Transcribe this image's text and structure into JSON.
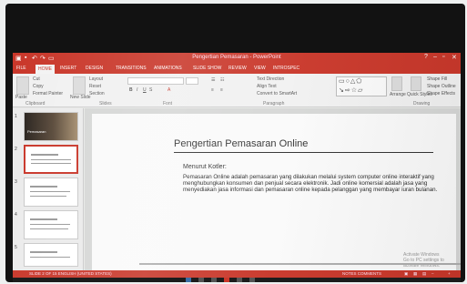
{
  "window": {
    "title": "Pengertian Pemasaran - PowerPoint",
    "qat_icons": [
      "save-icon",
      "undo-icon",
      "redo-icon",
      "slideshow-icon"
    ]
  },
  "tabs": [
    "FILE",
    "HOME",
    "INSERT",
    "DESIGN",
    "TRANSITIONS",
    "ANIMATIONS",
    "SLIDE SHOW",
    "REVIEW",
    "VIEW",
    "INTROSPEC"
  ],
  "active_tab": "HOME",
  "ribbon": {
    "clipboard": {
      "paste": "Paste",
      "cut": "Cut",
      "copy": "Copy",
      "format_painter": "Format Painter",
      "group": "Clipboard"
    },
    "slides": {
      "new_slide": "New Slide",
      "layout": "Layout",
      "reset": "Reset",
      "section": "Section",
      "group": "Slides"
    },
    "font": {
      "group": "Font"
    },
    "paragraph": {
      "text_direction": "Text Direction",
      "align_text": "Align Text",
      "convert": "Convert to SmartArt",
      "group": "Paragraph"
    },
    "drawing": {
      "arrange": "Arrange",
      "quick_styles": "Quick Styles",
      "shape_fill": "Shape Fill",
      "shape_outline": "Shape Outline",
      "shape_effects": "Shape Effects",
      "group": "Drawing"
    }
  },
  "thumbnails": [
    {
      "num": "1",
      "title": "Pemasaran"
    },
    {
      "num": "2"
    },
    {
      "num": "3"
    },
    {
      "num": "4"
    },
    {
      "num": "5"
    }
  ],
  "slide": {
    "title": "Pengertian Pemasaran Online",
    "subtitle": "Menurut Kotler:",
    "body": "Pemasaran Online adalah pemasaran yang dilakukan melalui system computer online interaktif yang menghubungkan konsumen dan penjual secara elektronik. Jadi online komersial adalah jasa yang menyediakan jasa informasi dan pemasaran online kepada pelanggan yang membayar iuran bulanan."
  },
  "watermark": {
    "line1": "Activate Windows",
    "line2": "Go to PC settings to activate Windows."
  },
  "status": {
    "left": "SLIDE 2 OF 15    ENGLISH (UNITED STATES)",
    "right": "NOTES    COMMENTS"
  }
}
